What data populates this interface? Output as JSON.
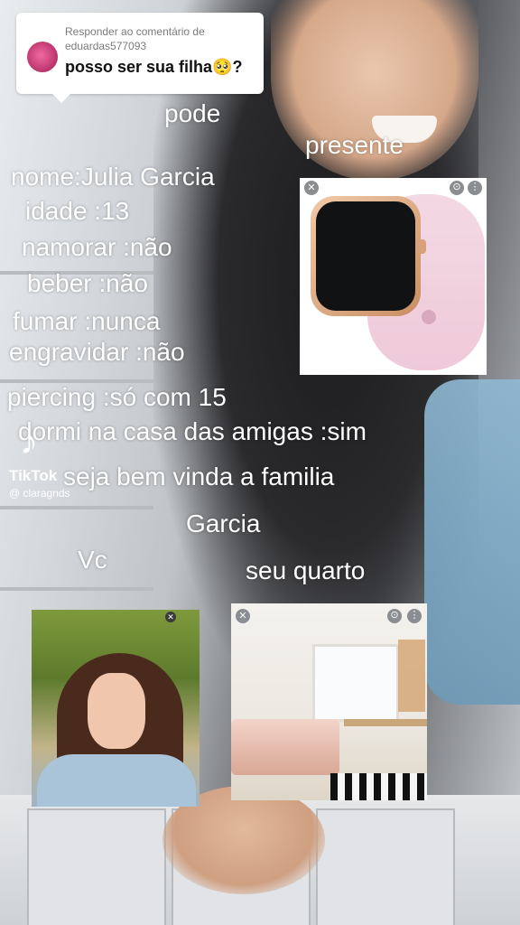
{
  "reply_card": {
    "label": "Responder ao comentário de eduardas577093",
    "comment": "posso ser sua filha🥺?"
  },
  "overlay": {
    "pode": "pode",
    "presente": "presente",
    "nome": "nome:Julia Garcia",
    "idade": "idade :13",
    "namorar": "namorar :não",
    "beber": "beber :não",
    "fumar": "fumar :nunca",
    "engravidar": "engravidar :não",
    "piercing": "piercing :só com 15",
    "dormir": "dormi na casa das amigas :sim",
    "bem_vinda": "seja bem vinda a familia",
    "garcia": "Garcia",
    "vc": "Vc",
    "quarto": "seu quarto"
  },
  "watermark": {
    "app": "TikTok",
    "username": "@ claragnds"
  },
  "icons": {
    "close": "close-icon",
    "more": "more-icon",
    "tiktok": "tiktok-logo-icon"
  }
}
